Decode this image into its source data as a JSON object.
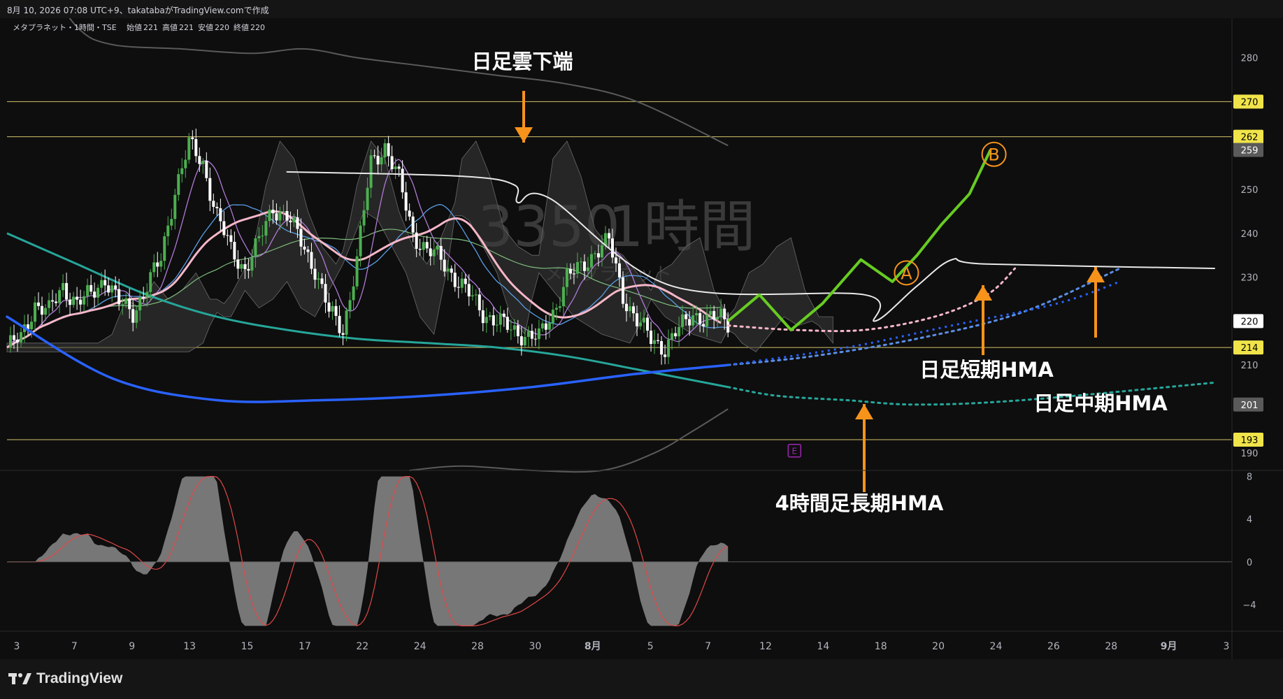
{
  "header": {
    "created": "8月 10, 2026 07:08 UTC+9、takatabaがTradingView.comで作成",
    "symbol_line": "メタプラネット・1時間・TSE",
    "ohlc": [
      {
        "label": "始値",
        "value": "221"
      },
      {
        "label": "高値",
        "value": "221"
      },
      {
        "label": "安値",
        "value": "220"
      },
      {
        "label": "終値",
        "value": "220"
      }
    ]
  },
  "watermark": {
    "symbol": "3350",
    "interval": "1時間",
    "name": "メタプラネット"
  },
  "footer": {
    "brand": "TradingView"
  },
  "colors": {
    "background": "#0e0e0e",
    "candle_up": "#4caf50",
    "candle_down": "#ffffff",
    "level_line": "#d4c46a",
    "hma_short": "#f5b7c8",
    "hma_mid": "#5a8ee6",
    "hma_long": "#26a69a",
    "hma_4h_long": "#2962ff",
    "scenario": "#66cc22",
    "annotation": "#f7931a"
  },
  "annotations": {
    "cloud_lower": "日足雲下端",
    "short_hma": "日足短期HMA",
    "mid_hma": "日足中期HMA",
    "long_hma_4h": "4時間足長期HMA",
    "point_a": "A",
    "point_b": "B",
    "earnings_marker": "E"
  },
  "chart_data": [
    {
      "type": "line",
      "title": "メタプラネット・1時間・TSE",
      "x_tick_labels": [
        "3",
        "7",
        "9",
        "13",
        "15",
        "17",
        "22",
        "24",
        "28",
        "30",
        "8月",
        "5",
        "7",
        "12",
        "14",
        "18",
        "20",
        "24",
        "26",
        "28",
        "9月",
        "3"
      ],
      "y_tick_labels": [
        280,
        270,
        250,
        240,
        230,
        220,
        210,
        190
      ],
      "ylim": [
        186,
        289
      ],
      "price_labels": [
        {
          "value": 270,
          "kind": "level"
        },
        {
          "value": 262,
          "kind": "level"
        },
        {
          "value": 259,
          "kind": "indicator"
        },
        {
          "value": 220,
          "kind": "last"
        },
        {
          "value": 214,
          "kind": "level"
        },
        {
          "value": 201,
          "kind": "indicator"
        },
        {
          "value": 193,
          "kind": "level"
        }
      ],
      "horizontal_levels": [
        270,
        262,
        214,
        193
      ],
      "price_path": [
        [
          0,
          214
        ],
        [
          4,
          216
        ],
        [
          8,
          224
        ],
        [
          12,
          222
        ],
        [
          16,
          228
        ],
        [
          20,
          224
        ],
        [
          24,
          226
        ],
        [
          28,
          230
        ],
        [
          32,
          224
        ],
        [
          36,
          222
        ],
        [
          40,
          228
        ],
        [
          44,
          234
        ],
        [
          48,
          250
        ],
        [
          52,
          260
        ],
        [
          56,
          256
        ],
        [
          60,
          244
        ],
        [
          64,
          236
        ],
        [
          68,
          232
        ],
        [
          72,
          238
        ],
        [
          76,
          246
        ],
        [
          80,
          244
        ],
        [
          84,
          238
        ],
        [
          88,
          232
        ],
        [
          92,
          222
        ],
        [
          96,
          218
        ],
        [
          100,
          234
        ],
        [
          104,
          256
        ],
        [
          108,
          260
        ],
        [
          112,
          252
        ],
        [
          116,
          240
        ],
        [
          120,
          236
        ],
        [
          124,
          234
        ],
        [
          128,
          230
        ],
        [
          132,
          226
        ],
        [
          136,
          222
        ],
        [
          140,
          220
        ],
        [
          144,
          218
        ],
        [
          148,
          217
        ],
        [
          152,
          216
        ],
        [
          156,
          222
        ],
        [
          160,
          230
        ],
        [
          164,
          232
        ],
        [
          168,
          236
        ],
        [
          172,
          238
        ],
        [
          176,
          226
        ],
        [
          180,
          220
        ],
        [
          184,
          216
        ],
        [
          188,
          214
        ],
        [
          192,
          218
        ],
        [
          196,
          222
        ],
        [
          200,
          220
        ],
        [
          204,
          221
        ],
        [
          206,
          220
        ]
      ],
      "series": [
        {
          "name": "日足短期HMA",
          "values": [
            [
              206,
              219
            ],
            [
              225,
              218
            ],
            [
              245,
              218
            ],
            [
              265,
              221
            ],
            [
              280,
              226
            ],
            [
              288,
              232
            ]
          ]
        },
        {
          "name": "日足中期HMA",
          "values": [
            [
              206,
              210
            ],
            [
              230,
              212
            ],
            [
              260,
              216
            ],
            [
              290,
              222
            ],
            [
              318,
              232
            ]
          ]
        },
        {
          "name": "日足中期HMA",
          "values": [
            [
              206,
              205
            ],
            [
              220,
              203
            ],
            [
              240,
              202
            ],
            [
              260,
              201
            ],
            [
              290,
              202
            ],
            [
              345,
              206
            ]
          ]
        },
        {
          "name": "4時間足長期HMA",
          "values": [
            [
              0,
              221
            ],
            [
              30,
              207
            ],
            [
              60,
              202
            ],
            [
              90,
              202
            ],
            [
              120,
              203
            ],
            [
              150,
              205
            ],
            [
              180,
              208
            ],
            [
              206,
              210
            ]
          ]
        },
        {
          "name": "日足雲下端",
          "values": [
            [
              80,
              254
            ],
            [
              130,
              253
            ],
            [
              145,
              251
            ],
            [
              146,
              247
            ],
            [
              155,
              248
            ],
            [
              190,
              228
            ],
            [
              245,
              226
            ],
            [
              248,
              220
            ],
            [
              260,
              228
            ],
            [
              270,
              234
            ],
            [
              280,
              233
            ],
            [
              345,
              232
            ]
          ]
        }
      ],
      "scenario_path": [
        [
          206,
          220
        ],
        [
          215,
          226
        ],
        [
          224,
          218
        ],
        [
          233,
          224
        ],
        [
          244,
          234
        ],
        [
          253,
          229
        ],
        [
          260,
          235
        ],
        [
          267,
          242
        ],
        [
          275,
          249
        ],
        [
          281,
          259
        ]
      ]
    },
    {
      "type": "area",
      "title": "",
      "y_tick_labels": [
        8,
        4,
        0,
        -4
      ],
      "ylim": [
        -6.5,
        8.5
      ]
    }
  ]
}
